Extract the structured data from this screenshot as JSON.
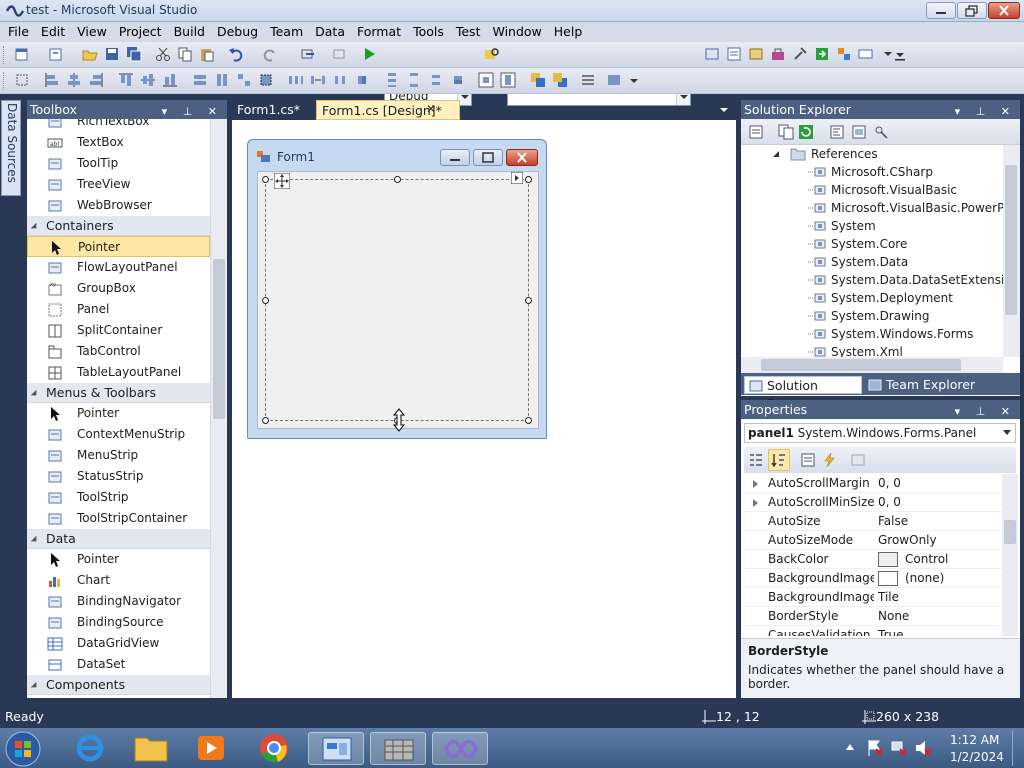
{
  "window": {
    "title": "test - Microsoft Visual Studio"
  },
  "menu": [
    "File",
    "Edit",
    "View",
    "Project",
    "Build",
    "Debug",
    "Team",
    "Data",
    "Format",
    "Tools",
    "Test",
    "Window",
    "Help"
  ],
  "toolbar": {
    "config_value": "Debug",
    "platform_value": ""
  },
  "data_sources_tab": "Data Sources",
  "toolbox": {
    "title": "Toolbox",
    "items": [
      {
        "label": "RichTextBox",
        "icon": "richtextbox-icon"
      },
      {
        "label": "TextBox",
        "icon": "textbox-icon"
      },
      {
        "label": "ToolTip",
        "icon": "tooltip-icon"
      },
      {
        "label": "TreeView",
        "icon": "treeview-icon"
      },
      {
        "label": "WebBrowser",
        "icon": "webbrowser-icon"
      }
    ],
    "categories": [
      {
        "name": "Containers",
        "items": [
          {
            "label": "Pointer",
            "icon": "pointer-icon",
            "selected": true
          },
          {
            "label": "FlowLayoutPanel",
            "icon": "flowlayoutpanel-icon"
          },
          {
            "label": "GroupBox",
            "icon": "groupbox-icon"
          },
          {
            "label": "Panel",
            "icon": "panel-icon"
          },
          {
            "label": "SplitContainer",
            "icon": "splitcontainer-icon"
          },
          {
            "label": "TabControl",
            "icon": "tabcontrol-icon"
          },
          {
            "label": "TableLayoutPanel",
            "icon": "tablelayoutpanel-icon"
          }
        ]
      },
      {
        "name": "Menus & Toolbars",
        "items": [
          {
            "label": "Pointer",
            "icon": "pointer-icon"
          },
          {
            "label": "ContextMenuStrip",
            "icon": "contextmenustrip-icon"
          },
          {
            "label": "MenuStrip",
            "icon": "menustrip-icon"
          },
          {
            "label": "StatusStrip",
            "icon": "statusstrip-icon"
          },
          {
            "label": "ToolStrip",
            "icon": "toolstrip-icon"
          },
          {
            "label": "ToolStripContainer",
            "icon": "toolstripcontainer-icon"
          }
        ]
      },
      {
        "name": "Data",
        "items": [
          {
            "label": "Pointer",
            "icon": "pointer-icon"
          },
          {
            "label": "Chart",
            "icon": "chart-icon"
          },
          {
            "label": "BindingNavigator",
            "icon": "bindingnavigator-icon"
          },
          {
            "label": "BindingSource",
            "icon": "bindingsource-icon"
          },
          {
            "label": "DataGridView",
            "icon": "datagridview-icon"
          },
          {
            "label": "DataSet",
            "icon": "dataset-icon"
          }
        ]
      },
      {
        "name": "Components",
        "items": [
          {
            "label": "Pointer",
            "icon": "pointer-icon"
          }
        ]
      }
    ]
  },
  "tabs": [
    {
      "label": "Form1.cs*",
      "active": false
    },
    {
      "label": "Form1.cs [Design]*",
      "active": true
    }
  ],
  "designer": {
    "form_title": "Form1"
  },
  "solution_explorer": {
    "title": "Solution Explorer",
    "references_label": "References",
    "references": [
      "Microsoft.CSharp",
      "Microsoft.VisualBasic",
      "Microsoft.VisualBasic.PowerPacl",
      "System",
      "System.Core",
      "System.Data",
      "System.Data.DataSetExtensions",
      "System.Deployment",
      "System.Drawing",
      "System.Windows.Forms",
      "System.Xml"
    ],
    "bottom_tabs": [
      "Solution Explorer",
      "Team Explorer"
    ]
  },
  "properties": {
    "title": "Properties",
    "object_name": "panel1",
    "object_type": "System.Windows.Forms.Panel",
    "rows": [
      {
        "name": "AutoScrollMargin",
        "value": "0, 0",
        "expandable": true
      },
      {
        "name": "AutoScrollMinSize",
        "value": "0, 0",
        "expandable": true
      },
      {
        "name": "AutoSize",
        "value": "False"
      },
      {
        "name": "AutoSizeMode",
        "value": "GrowOnly"
      },
      {
        "name": "BackColor",
        "value": "Control",
        "swatch": "#f0f0f0"
      },
      {
        "name": "BackgroundImage",
        "value": "(none)",
        "swatch": "#ffffff"
      },
      {
        "name": "BackgroundImageLa",
        "value": "Tile"
      },
      {
        "name": "BorderStyle",
        "value": "None"
      },
      {
        "name": "CausesValidation",
        "value": "True"
      }
    ],
    "desc_title": "BorderStyle",
    "desc_text": "Indicates whether the panel should have a border."
  },
  "status": {
    "text": "Ready",
    "position": "12 , 12",
    "size": "260 x 238"
  },
  "taskbar": {
    "apps": [
      "windows-start-icon",
      "internet-explorer-icon",
      "file-explorer-icon",
      "media-player-icon",
      "chrome-icon",
      "control-panel-icon",
      "sql-server-icon",
      "visual-studio-icon"
    ],
    "time": "1:12 AM",
    "date": "1/2/2024"
  },
  "colors": {
    "chrome_dark": "#293955",
    "panel_header": "#4d6082",
    "selection": "#ffe8a6",
    "active_tab": "#fff1c2"
  }
}
